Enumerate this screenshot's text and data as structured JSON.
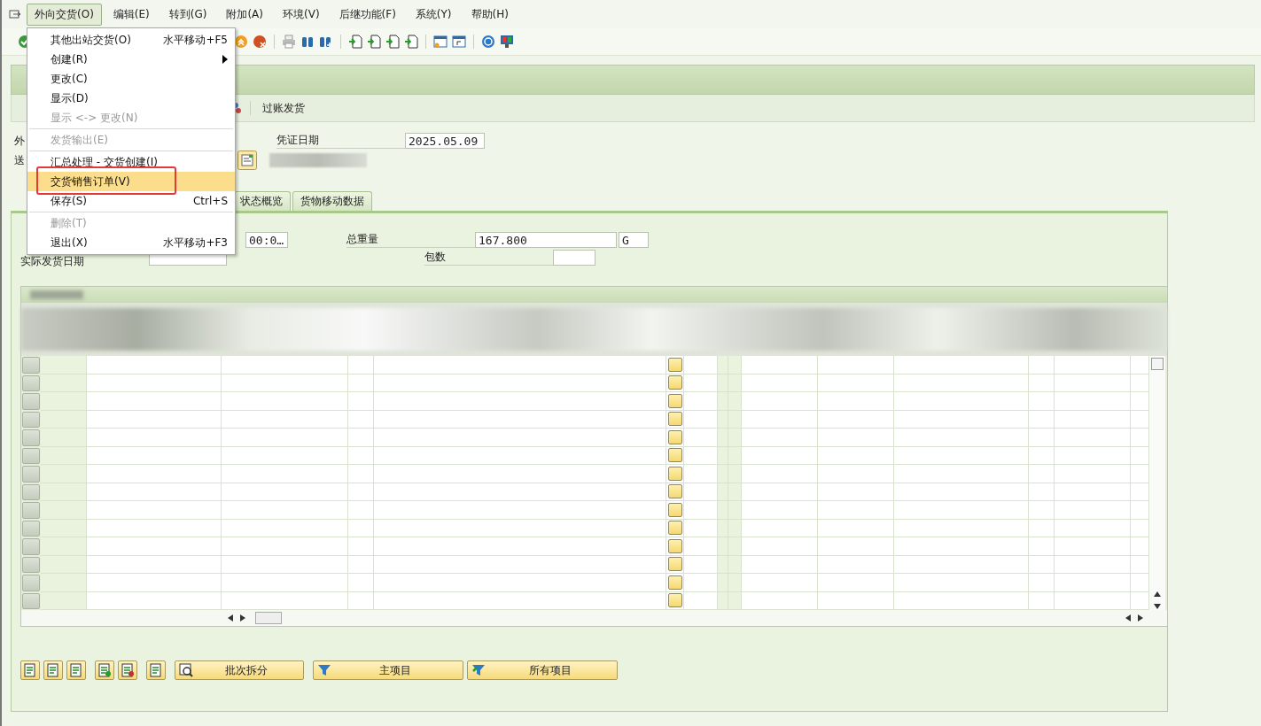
{
  "menubar": [
    {
      "label": "外向交货(O)",
      "selected": true
    },
    {
      "label": "编辑(E)",
      "selected": false
    },
    {
      "label": "转到(G)",
      "selected": false
    },
    {
      "label": "附加(A)",
      "selected": false
    },
    {
      "label": "环境(V)",
      "selected": false
    },
    {
      "label": "后继功能(F)",
      "selected": false
    },
    {
      "label": "系统(Y)",
      "selected": false
    },
    {
      "label": "帮助(H)",
      "selected": false
    }
  ],
  "menu": {
    "items": [
      {
        "kind": "item",
        "label": "其他出站交货(O)",
        "shortcut": "水平移动+F5",
        "disabled": false,
        "submenu": false,
        "selected": false,
        "outlined": false
      },
      {
        "kind": "item",
        "label": "创建(R)",
        "disabled": false,
        "submenu": true,
        "selected": false,
        "outlined": false
      },
      {
        "kind": "item",
        "label": "更改(C)",
        "disabled": false,
        "submenu": false,
        "selected": false,
        "outlined": false
      },
      {
        "kind": "item",
        "label": "显示(D)",
        "disabled": false,
        "submenu": false,
        "selected": false,
        "outlined": false
      },
      {
        "kind": "item",
        "label": "显示 <-> 更改(N)",
        "disabled": true,
        "submenu": false,
        "selected": false,
        "outlined": false
      },
      {
        "kind": "separator"
      },
      {
        "kind": "item",
        "label": "发货输出(E)",
        "disabled": true,
        "submenu": false,
        "selected": false,
        "outlined": false
      },
      {
        "kind": "separator"
      },
      {
        "kind": "item",
        "label": "汇总处理 - 交货创建(I)",
        "disabled": false,
        "submenu": false,
        "selected": false,
        "outlined": false
      },
      {
        "kind": "item",
        "label": "交货销售订单(V)",
        "disabled": false,
        "submenu": false,
        "selected": true,
        "outlined": true
      },
      {
        "kind": "item",
        "label": "保存(S)",
        "shortcut": "Ctrl+S",
        "disabled": false,
        "submenu": false,
        "selected": false,
        "outlined": false
      },
      {
        "kind": "separator"
      },
      {
        "kind": "item",
        "label": "删除(T)",
        "disabled": true,
        "submenu": false,
        "selected": false,
        "outlined": false
      },
      {
        "kind": "item",
        "label": "退出(X)",
        "shortcut": "水平移动+F3",
        "disabled": false,
        "submenu": false,
        "selected": false,
        "outlined": false
      }
    ]
  },
  "app_toolbar": {
    "post_button": "过账发货"
  },
  "header": {
    "label_1": "外",
    "label_2": "送",
    "date_label": "凭证日期",
    "date_value": "2025.05.09"
  },
  "tabs": [
    {
      "label": "状态概览",
      "selected": false
    },
    {
      "label": "货物移动数据",
      "selected": false
    }
  ],
  "fields": {
    "time_value": "00:0…",
    "actual_date_label": "实际发货日期",
    "weight_label": "总重量",
    "weight_value": "167.800",
    "weight_unit": "G",
    "packages_label": "包数"
  },
  "table": {
    "rows": [
      {
        "selected": false
      },
      {
        "selected": false
      },
      {
        "selected": false
      },
      {
        "selected": false
      },
      {
        "selected": false
      },
      {
        "selected": false
      },
      {
        "selected": false
      },
      {
        "selected": false
      },
      {
        "selected": false
      },
      {
        "selected": false
      },
      {
        "selected": false
      },
      {
        "selected": false
      },
      {
        "selected": false
      },
      {
        "selected": false
      }
    ]
  },
  "buttons": [
    {
      "kind": "batch",
      "label": "批次拆分"
    },
    {
      "kind": "filter",
      "label": "主项目"
    },
    {
      "kind": "all",
      "label": "所有项目"
    }
  ]
}
